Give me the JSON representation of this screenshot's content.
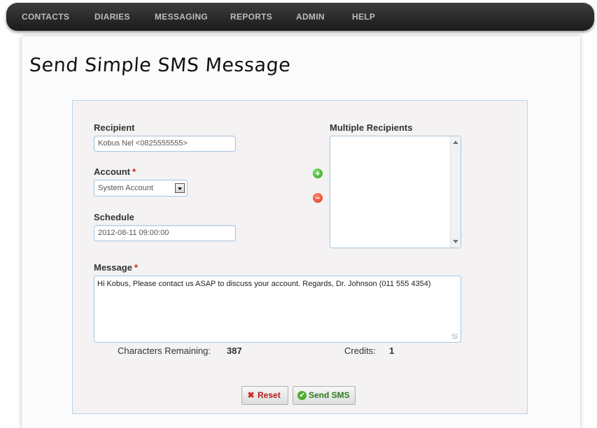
{
  "nav": {
    "items": [
      {
        "label": "CONTACTS"
      },
      {
        "label": "DIARIES"
      },
      {
        "label": "MESSAGING"
      },
      {
        "label": "REPORTS"
      },
      {
        "label": "ADMIN"
      },
      {
        "label": "HELP"
      }
    ]
  },
  "page": {
    "title": "Send Simple SMS Message"
  },
  "form": {
    "recipient_label": "Recipient",
    "recipient_value": "Kobus Nel <0825555555>",
    "account_label": "Account",
    "required_mark": "*",
    "account_value": "System Account",
    "schedule_label": "Schedule",
    "schedule_value": "2012-08-11 09:00:00",
    "multiple_recipients_label": "Multiple Recipients",
    "message_label": "Message",
    "message_value": "Hi Kobus, Please contact us ASAP to discuss your account. Regards, Dr. Johnson (011 555 4354)",
    "add_icon": "plus-icon",
    "remove_icon": "minus-icon"
  },
  "stats": {
    "chars_label": "Characters Remaining:",
    "chars_value": "387",
    "credits_label": "Credits:",
    "credits_value": "1"
  },
  "buttons": {
    "reset_label": "Reset",
    "reset_icon": "x-icon",
    "send_label": "Send SMS",
    "send_icon": "check-icon"
  },
  "colors": {
    "navbar": "#2b2b2b",
    "form_border": "#b7d3e8",
    "required": "#cc2222",
    "add": "#2f9e1e",
    "remove": "#d83a1a"
  }
}
